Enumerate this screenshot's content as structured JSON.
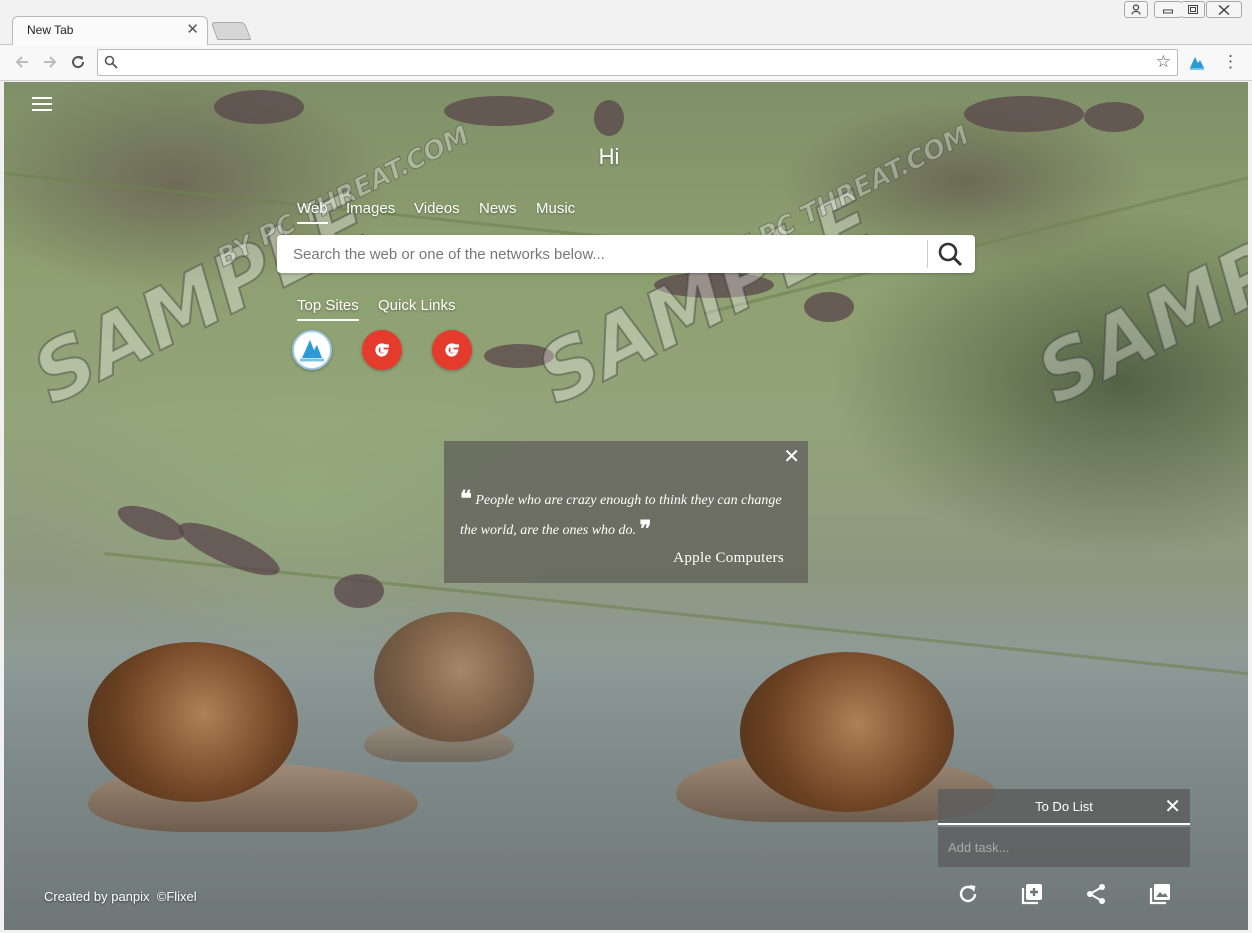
{
  "browser": {
    "tab_title": "New Tab",
    "tab_close_glyph": "✕",
    "address_value": "",
    "window_buttons": [
      "user-icon",
      "minimize-icon",
      "restore-icon",
      "close-icon"
    ]
  },
  "page": {
    "greeting": "Hi",
    "search_tabs": [
      {
        "label": "Web",
        "active": true
      },
      {
        "label": "Images",
        "active": false
      },
      {
        "label": "Videos",
        "active": false
      },
      {
        "label": "News",
        "active": false
      },
      {
        "label": "Music",
        "active": false
      }
    ],
    "search_placeholder": "Search the web or one of the networks below...",
    "site_tabs": [
      {
        "label": "Top Sites",
        "active": true
      },
      {
        "label": "Quick Links",
        "active": false
      }
    ],
    "top_sites": [
      "blue-extension-icon",
      "google-icon",
      "google-icon"
    ],
    "quote": {
      "text": "People who are crazy enough to think they can change the world, are the ones who do.",
      "author": "Apple Computers"
    },
    "todo": {
      "title": "To Do List",
      "placeholder": "Add task..."
    },
    "credit": {
      "prefix": "Created by",
      "author": "panpix",
      "source": "©Flixel"
    },
    "bottom_icons": [
      "refresh-icon",
      "add-note-icon",
      "share-icon",
      "gallery-icon"
    ]
  },
  "watermark": {
    "main": "SAMPLE",
    "sub": "BY PC THREAT.COM"
  },
  "colors": {
    "google_red": "#e53b2c",
    "overlay_dark": "#5f5f5f"
  }
}
